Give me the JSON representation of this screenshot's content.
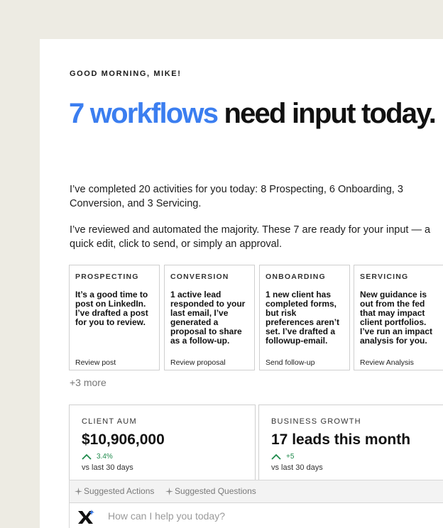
{
  "greeting": "GOOD MORNING, MIKE!",
  "headline": {
    "accent": "7 workflows",
    "rest": " need input today."
  },
  "intro": "I’ve completed 20 activities for you today: 8 Prospecting, 6 Onboarding, 3 Conversion, and 3 Servicing.",
  "review_note": "I’ve reviewed and automated the majority. These 7 are ready for your input — a quick edit, click to send, or simply an approval.",
  "colors": {
    "accent_blue": "#3b7ef0",
    "positive_green": "#1f8a4c",
    "page_background": "#edebe3"
  },
  "cards": [
    {
      "category": "PROSPECTING",
      "body": "It’s a good time to post on LinkedIn. I’ve drafted a post for you to review.",
      "action": "Review post"
    },
    {
      "category": "CONVERSION",
      "body": "1 active lead responded to your last email, I’ve generated a proposal to share as a follow-up.",
      "action": "Review proposal"
    },
    {
      "category": "ONBOARDING",
      "body": "1 new client has completed forms, but risk preferences aren’t set. I’ve drafted a followup-email.",
      "action": "Send follow-up"
    },
    {
      "category": "SERVICING",
      "body": "New guidance is out from the fed that may impact client portfolios. I’ve run an impact analysis for you.",
      "action": "Review Analysis"
    }
  ],
  "more_link": "+3 more",
  "metrics": [
    {
      "label": "CLIENT AUM",
      "value": "$10,906,000",
      "change": "3.4%",
      "change_icon": "arrow-up-icon",
      "period": "vs last 30 days"
    },
    {
      "label": "BUSINESS GROWTH",
      "value": "17 leads this month",
      "change": "+5",
      "change_icon": "arrow-up-icon",
      "period": "vs last 30 days"
    }
  ],
  "suggestions": {
    "actions_label": "Suggested Actions",
    "questions_label": "Suggested Questions",
    "icon": "sparkle-icon"
  },
  "chat": {
    "placeholder": "How can I help you today?",
    "logo_icon": "assistant-logo-icon"
  }
}
